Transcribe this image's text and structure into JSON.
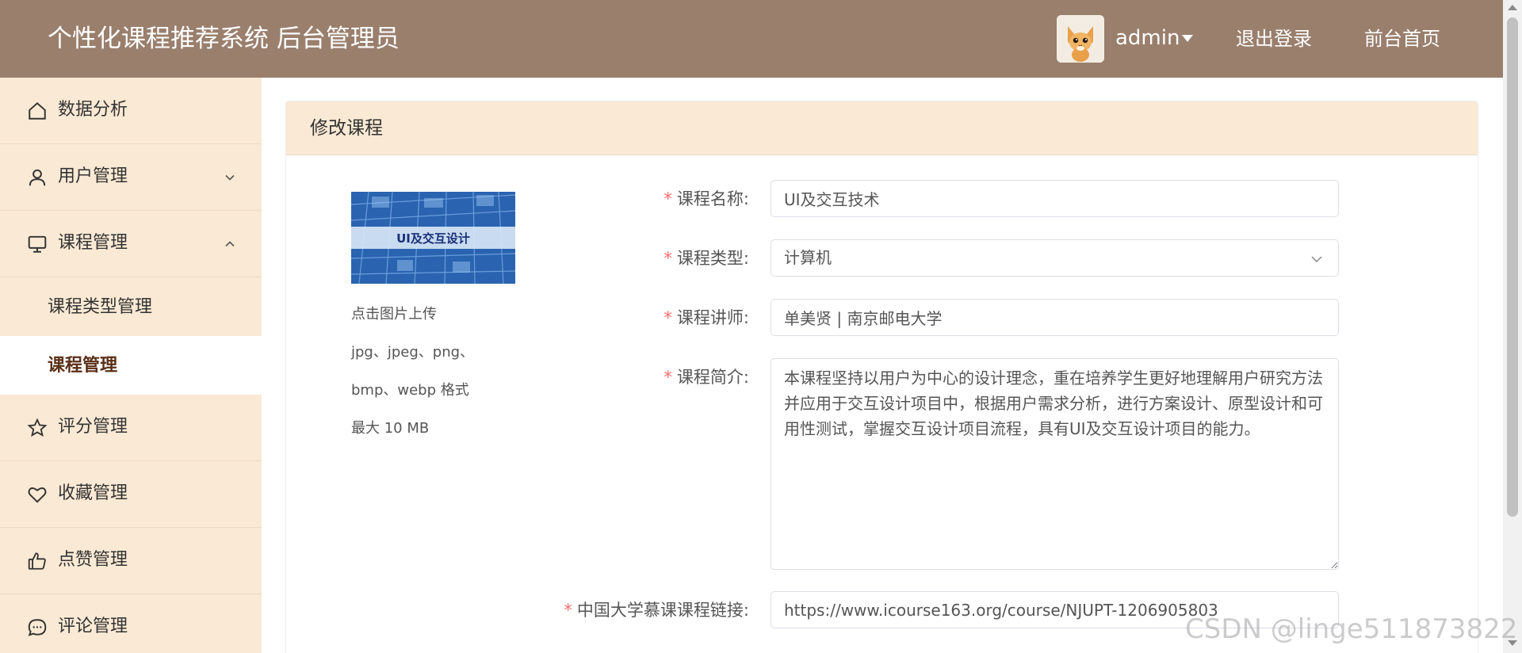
{
  "header": {
    "app_title": "个性化课程推荐系统 后台管理员",
    "username": "admin",
    "logout_label": "退出登录",
    "frontpage_label": "前台首页",
    "background_color": "#9a7f6d"
  },
  "sidebar": {
    "background_color": "#fae9d4",
    "items": [
      {
        "label": "数据分析",
        "icon": "home-icon"
      },
      {
        "label": "用户管理",
        "icon": "user-icon",
        "expanded": false
      },
      {
        "label": "课程管理",
        "icon": "monitor-icon",
        "expanded": true
      },
      {
        "label": "评分管理",
        "icon": "star-icon"
      },
      {
        "label": "收藏管理",
        "icon": "heart-icon"
      },
      {
        "label": "点赞管理",
        "icon": "thumbs-up-icon"
      },
      {
        "label": "评论管理",
        "icon": "chat-icon"
      }
    ],
    "sub_items": [
      {
        "label": "课程类型管理",
        "active": false
      },
      {
        "label": "课程管理",
        "active": true
      }
    ]
  },
  "panel": {
    "title": "修改课程",
    "cover_caption": "UI及交互设计",
    "upload_hint": "点击图片上传",
    "formats_line1": "jpg、jpeg、png、",
    "formats_line2": "bmp、webp 格式",
    "max_size": "最大 10 MB"
  },
  "form": {
    "required_mark": "*",
    "name_label": "课程名称:",
    "name_value": "UI及交互技术",
    "type_label": "课程类型:",
    "type_value": "计算机",
    "teacher_label": "课程讲师:",
    "teacher_value": "单美贤 | 南京邮电大学",
    "intro_label": "课程简介:",
    "intro_value": "本课程坚持以用户为中心的设计理念，重在培养学生更好地理解用户研究方法并应用于交互设计项目中，根据用户需求分析，进行方案设计、原型设计和可用性测试，掌握交互设计项目流程，具有UI及交互设计项目的能力。",
    "link_label": "中国大学慕课课程链接:",
    "link_value": "https://www.icourse163.org/course/NJUPT-1206905803"
  },
  "watermark": "CSDN @linge511873822"
}
